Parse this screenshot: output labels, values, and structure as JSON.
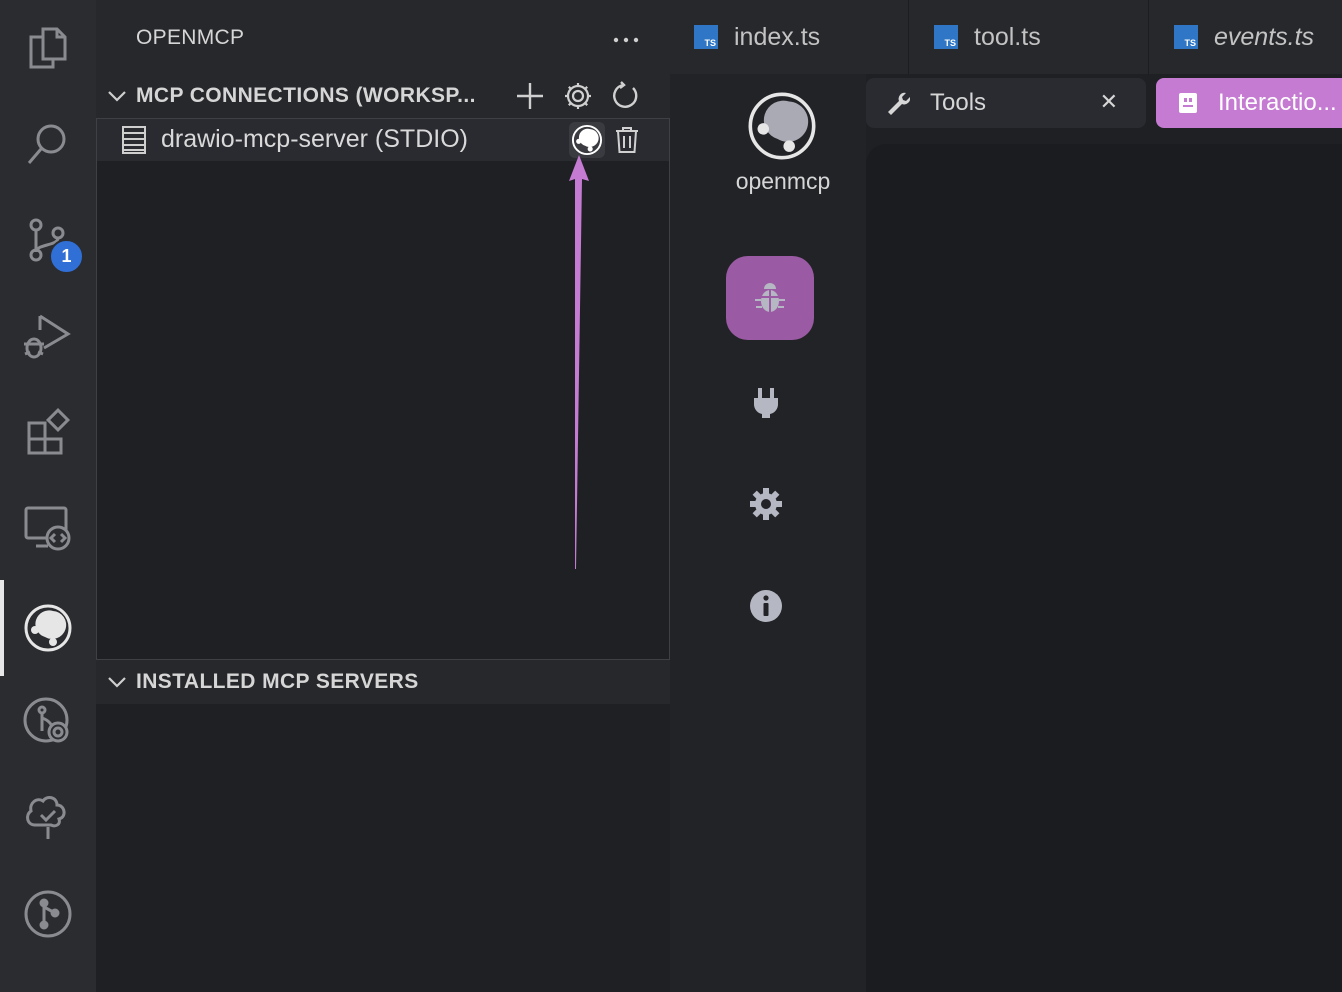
{
  "activity_bar": {
    "items": [
      {
        "name": "explorer",
        "icon": "files-icon"
      },
      {
        "name": "search",
        "icon": "search-icon"
      },
      {
        "name": "source-control",
        "icon": "source-control-icon",
        "badge": "1"
      },
      {
        "name": "run-debug",
        "icon": "run-debug-icon"
      },
      {
        "name": "extensions",
        "icon": "extensions-icon"
      },
      {
        "name": "remote-explorer",
        "icon": "remote-explorer-icon"
      },
      {
        "name": "openmcp",
        "icon": "openmcp-logo-icon",
        "active": true
      },
      {
        "name": "gitlens",
        "icon": "gitlens-icon"
      },
      {
        "name": "testing",
        "icon": "tree-check-icon"
      },
      {
        "name": "git-graph",
        "icon": "git-graph-icon"
      }
    ]
  },
  "sidebar": {
    "title": "OPENMCP",
    "more_label": "···",
    "connections_section": {
      "title": "MCP CONNECTIONS (WORKSP...",
      "actions": [
        "add-icon",
        "gear-icon",
        "refresh-icon"
      ],
      "items": [
        {
          "label": "drawio-mcp-server (STDIO)",
          "icon": "server-icon",
          "actions": [
            "openmcp-logo-icon",
            "trash-icon"
          ]
        }
      ]
    },
    "installed_section": {
      "title": "INSTALLED MCP SERVERS"
    }
  },
  "tabs": [
    {
      "label": "index.ts",
      "icon_text": "TS",
      "italic": false
    },
    {
      "label": "tool.ts",
      "icon_text": "TS",
      "italic": false
    },
    {
      "label": "events.ts",
      "icon_text": "TS",
      "italic": true
    }
  ],
  "editor": {
    "brand_label": "openmcp",
    "nav_buttons": [
      {
        "name": "debug",
        "icon": "bug-icon",
        "active": true
      },
      {
        "name": "connect",
        "icon": "plug-icon"
      },
      {
        "name": "settings",
        "icon": "gear-icon"
      },
      {
        "name": "about",
        "icon": "info-icon"
      }
    ],
    "panel_tabs": [
      {
        "label": "Tools",
        "icon": "wrench-icon",
        "closable": true
      },
      {
        "label": "Interactio...",
        "icon": "robot-icon",
        "active": true
      }
    ],
    "close_label": "✕"
  },
  "colors": {
    "accent_purple": "#9b5ba4",
    "tab_active_purple": "#c57bd2",
    "badge_blue": "#2f6fd6",
    "ts_blue": "#2f76c7",
    "annotation_arrow": "#c57bd2"
  }
}
